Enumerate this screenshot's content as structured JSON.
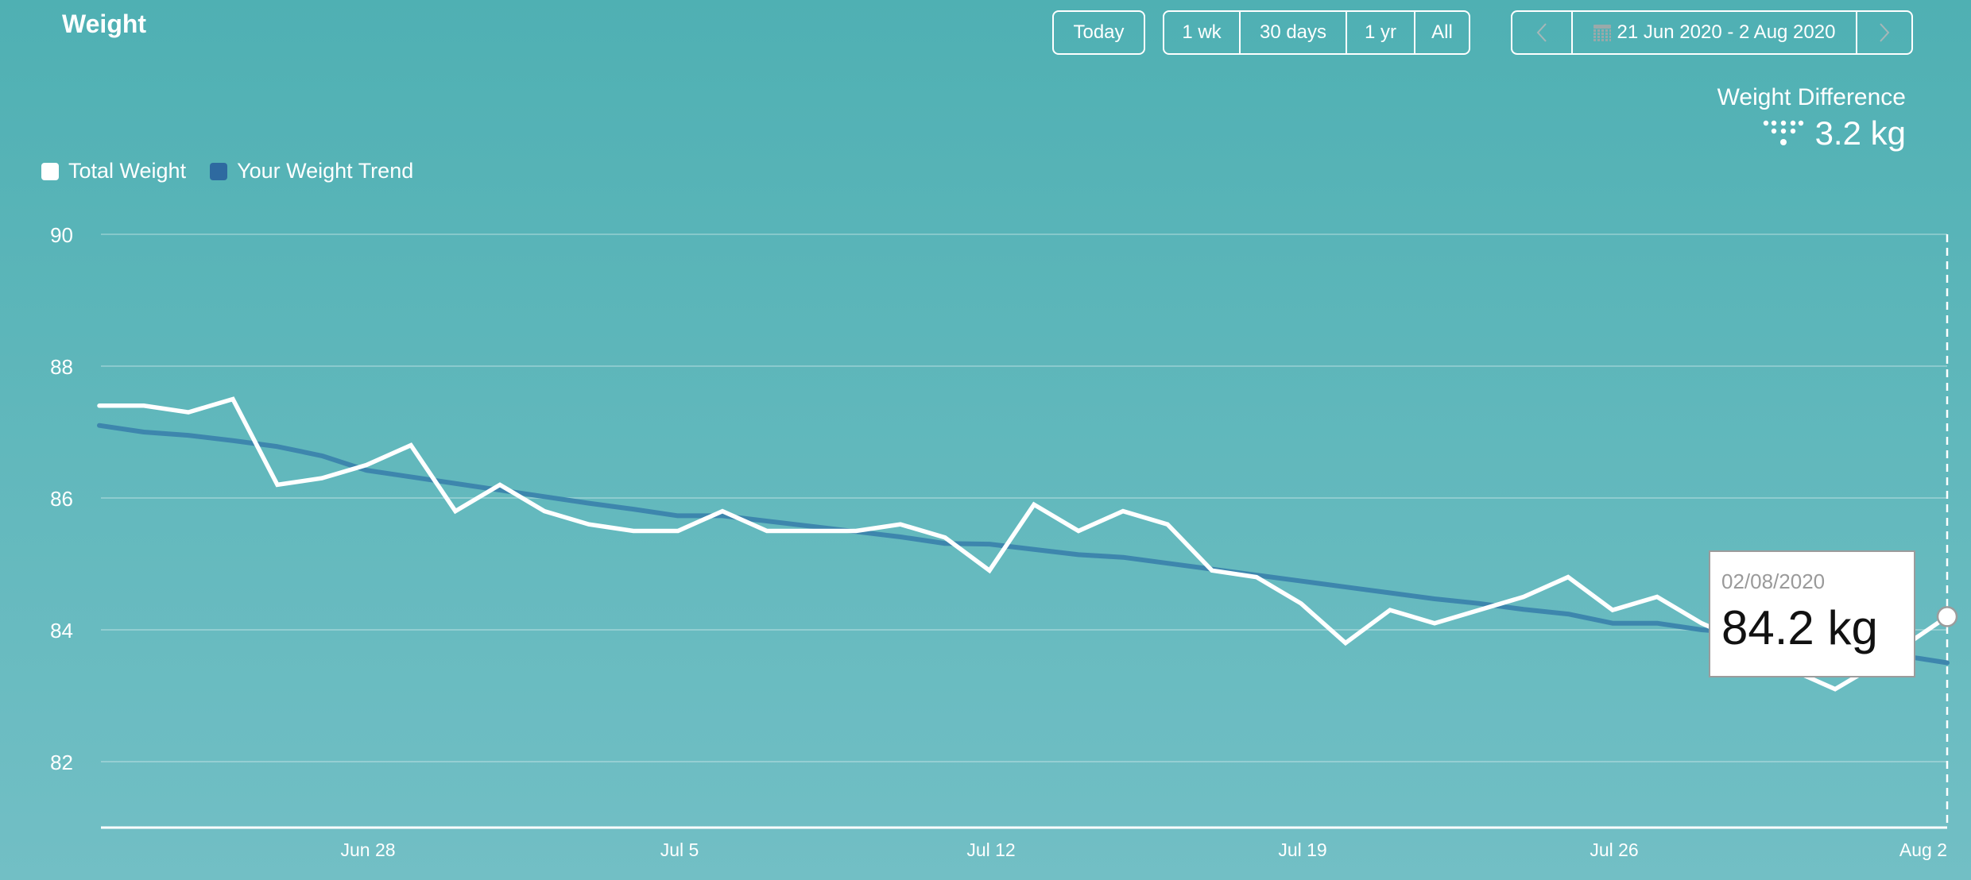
{
  "header": {
    "title": "Weight",
    "today_label": "Today",
    "ranges": [
      "1 wk",
      "30 days",
      "1 yr",
      "All"
    ],
    "prev_icon": "chevron-left-icon",
    "next_icon": "chevron-right-icon",
    "calendar_icon": "calendar-icon",
    "date_range": "21 Jun 2020 - 2 Aug 2020"
  },
  "summary": {
    "label": "Weight Difference",
    "icon": "down-arrow-dots-icon",
    "value": "3.2 kg"
  },
  "tooltip": {
    "date": "02/08/2020",
    "value": "84.2 kg"
  },
  "colors": {
    "total_weight": "#ffffff",
    "trend": "#2e6aa0",
    "trend_line": "#3d86ad"
  },
  "chart_data": {
    "type": "line",
    "title": "Weight",
    "xlabel": "",
    "ylabel": "kg",
    "ylim": [
      81,
      90
    ],
    "yticks": [
      82,
      84,
      86,
      88,
      90
    ],
    "grid": true,
    "legend_position": "top-left",
    "x_tick_labels": [
      "Jun 28",
      "Jul 5",
      "Jul 12",
      "Jul 19",
      "Jul 26",
      "Aug 2"
    ],
    "x": [
      "Jun 22",
      "Jun 23",
      "Jun 24",
      "Jun 25",
      "Jun 26",
      "Jun 27",
      "Jun 28",
      "Jun 29",
      "Jun 30",
      "Jul 1",
      "Jul 2",
      "Jul 3",
      "Jul 4",
      "Jul 5",
      "Jul 6",
      "Jul 7",
      "Jul 8",
      "Jul 9",
      "Jul 10",
      "Jul 11",
      "Jul 12",
      "Jul 13",
      "Jul 14",
      "Jul 15",
      "Jul 16",
      "Jul 17",
      "Jul 18",
      "Jul 19",
      "Jul 20",
      "Jul 21",
      "Jul 22",
      "Jul 23",
      "Jul 24",
      "Jul 25",
      "Jul 26",
      "Jul 27",
      "Jul 28",
      "Jul 29",
      "Jul 30",
      "Jul 31",
      "Aug 1",
      "Aug 2"
    ],
    "series": [
      {
        "name": "Total Weight",
        "values": [
          87.4,
          87.4,
          87.3,
          87.5,
          86.2,
          86.3,
          86.5,
          86.8,
          85.8,
          86.2,
          85.8,
          85.6,
          85.5,
          85.5,
          85.8,
          85.5,
          85.5,
          85.5,
          85.6,
          85.4,
          84.9,
          85.9,
          85.5,
          85.8,
          85.6,
          84.9,
          84.8,
          84.4,
          83.8,
          84.3,
          84.1,
          84.3,
          84.5,
          84.8,
          84.3,
          84.5,
          84.1,
          83.8,
          83.4,
          83.1,
          83.5,
          84.2
        ]
      },
      {
        "name": "Your Weight Trend",
        "values": [
          87.1,
          87.0,
          86.95,
          86.87,
          86.78,
          86.64,
          86.42,
          86.32,
          86.22,
          86.12,
          86.02,
          85.92,
          85.83,
          85.73,
          85.73,
          85.65,
          85.57,
          85.49,
          85.41,
          85.31,
          85.3,
          85.22,
          85.14,
          85.1,
          85.01,
          84.92,
          84.83,
          84.74,
          84.65,
          84.56,
          84.47,
          84.4,
          84.31,
          84.24,
          84.1,
          84.1,
          84.0,
          83.95,
          83.88,
          83.8,
          83.66,
          83.5
        ]
      }
    ],
    "highlight": {
      "x": "Aug 2",
      "value": 84.2
    }
  }
}
